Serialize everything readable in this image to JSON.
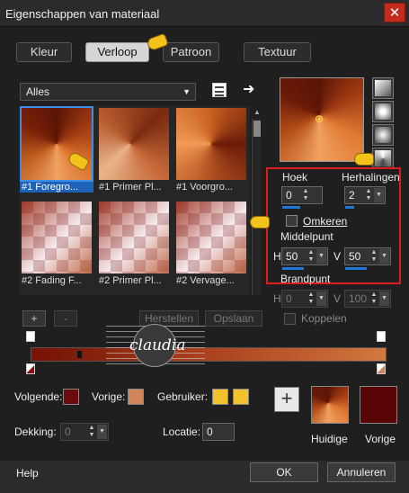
{
  "window": {
    "title": "Eigenschappen van materiaal",
    "close_glyph": "✕"
  },
  "tabs": [
    {
      "label": "Kleur",
      "active": false
    },
    {
      "label": "Verloop",
      "active": true
    },
    {
      "label": "Patroon",
      "active": false
    },
    {
      "label": "Textuur",
      "active": false
    }
  ],
  "category": {
    "value": "Alles"
  },
  "gradients": [
    {
      "label": "#1 Foregro...",
      "selected": true
    },
    {
      "label": "#1 Primer Pl...",
      "selected": false
    },
    {
      "label": "#1 Voorgro...",
      "selected": false
    },
    {
      "label": "#2 Fading F...",
      "selected": false
    },
    {
      "label": "#2 Primer Pl...",
      "selected": false
    },
    {
      "label": "#2 Vervage...",
      "selected": false
    }
  ],
  "settings": {
    "hoek_label": "Hoek",
    "hoek_value": "0",
    "herhalingen_label": "Herhalingen",
    "herhalingen_value": "2",
    "omkeren_label": "Omkeren",
    "middelpunt_label": "Middelpunt",
    "h_label": "H",
    "h_value": "50",
    "v_label": "V",
    "v_value": "50",
    "brandpunt_label": "Brandpunt",
    "bh_label": "H",
    "bh_value": "0",
    "bv_label": "V",
    "bv_value": "100",
    "koppelen_label": "Koppelen"
  },
  "stop_buttons": {
    "add": "+",
    "remove": "-",
    "herstellen": "Herstellen",
    "opslaan": "Opslaan"
  },
  "watermark": {
    "text": "claudia"
  },
  "colors": {
    "volgende_label": "Volgende:",
    "vorige_label": "Vorige:",
    "gebruiker_label": "Gebruiker:",
    "volgende_color": "#6b0c0c",
    "vorige_color": "#d0865a",
    "gebruiker_color1": "#f2c12e",
    "gebruiker_color2": "#f2c12e",
    "plus": "+",
    "huidige_label": "Huidige",
    "vorige_big_label": "Vorige",
    "vorige_big_color": "#5a0606"
  },
  "opacity": {
    "dekking_label": "Dekking:",
    "dekking_value": "0",
    "locatie_label": "Locatie:",
    "locatie_value": "0"
  },
  "footer": {
    "help": "Help",
    "ok": "OK",
    "cancel": "Annuleren"
  }
}
